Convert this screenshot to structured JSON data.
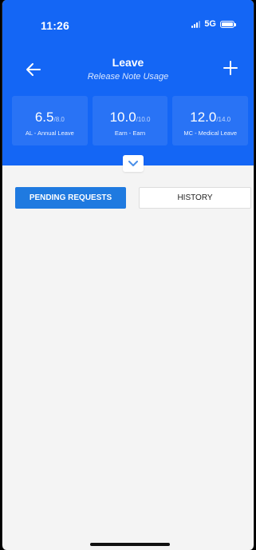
{
  "status": {
    "time": "11:26",
    "network": "5G"
  },
  "nav": {
    "title": "Leave",
    "subtitle": "Release Note Usage"
  },
  "balances": [
    {
      "value": "6.5",
      "total": "/8.0",
      "label": "AL - Annual Leave"
    },
    {
      "value": "10.0",
      "total": "/10.0",
      "label": "Earn - Earn"
    },
    {
      "value": "12.0",
      "total": "/14.0",
      "label": "MC - Medical Leave"
    }
  ],
  "tabs": {
    "pending": "PENDING REQUESTS",
    "history": "HISTORY"
  },
  "colors": {
    "primary": "#1466f5",
    "tab_active": "#1f7ae0",
    "background": "#f4f4f4"
  },
  "icons": {
    "back": "arrow-left-icon",
    "add": "plus-icon",
    "expand": "chevron-down-icon"
  }
}
